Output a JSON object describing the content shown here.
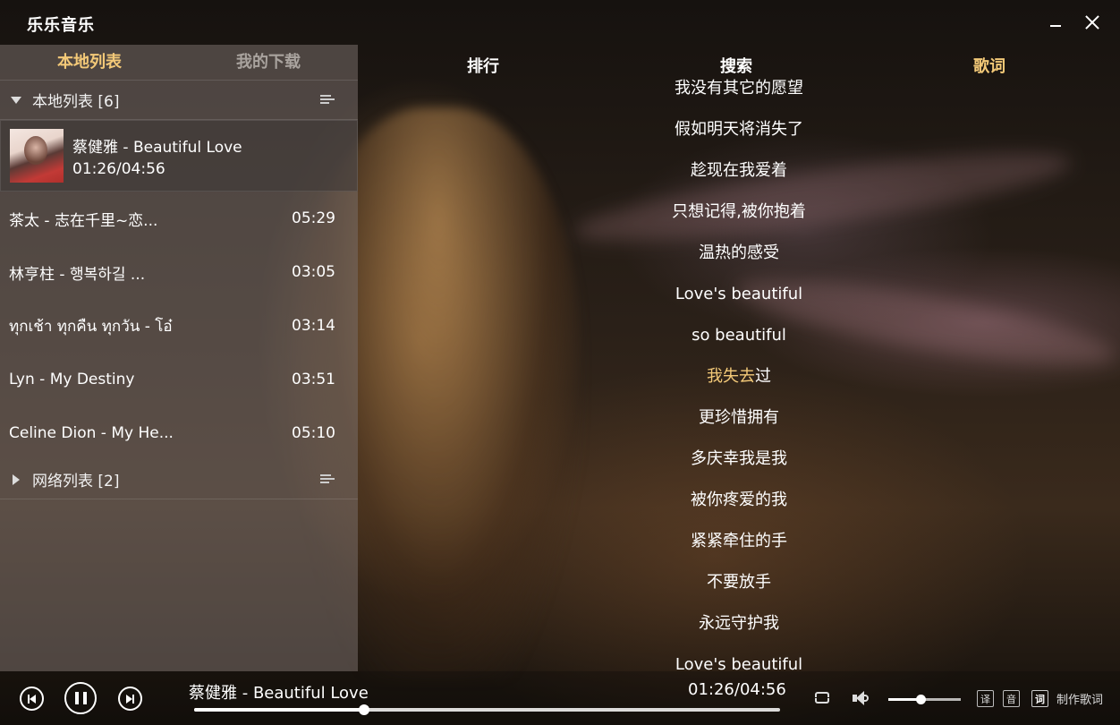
{
  "app": {
    "title": "乐乐音乐"
  },
  "left_tabs": [
    {
      "label": "本地列表",
      "active": true
    },
    {
      "label": "我的下载",
      "active": false
    }
  ],
  "nav_tabs": [
    {
      "label": "排行",
      "active": false
    },
    {
      "label": "搜索",
      "active": false
    },
    {
      "label": "歌词",
      "active": true
    }
  ],
  "local_group": {
    "label": "本地列表 [6]"
  },
  "current_song": {
    "title": "蔡健雅 - Beautiful Love",
    "time": "01:26/04:56"
  },
  "songs": [
    {
      "title": "茶太 - 志在千里~恋...",
      "duration": "05:29"
    },
    {
      "title": "林亨柱 - 행복하길 ...",
      "duration": "03:05"
    },
    {
      "title": "ทุกเช้า ทุกคืน ทุกวัน - โอ๋",
      "duration": "03:14"
    },
    {
      "title": "Lyn - My Destiny",
      "duration": "03:51"
    },
    {
      "title": "Celine Dion - My He...",
      "duration": "05:10"
    }
  ],
  "network_group": {
    "label": "网络列表 [2]"
  },
  "lyrics": [
    "我没有其它的愿望",
    "假如明天将消失了",
    "趁现在我爱着",
    "只想记得,被你抱着",
    "温热的感受",
    "Love's beautiful",
    "so beautiful",
    "我失去过",
    "更珍惜拥有",
    "多庆幸我是我",
    "被你疼爱的我",
    "紧紧牵住的手",
    "不要放手",
    "永远守护我",
    "Love's beautiful"
  ],
  "current_lyric": {
    "index": 7,
    "highlighted": "我失去",
    "rest": "过"
  },
  "player": {
    "title": "蔡健雅 - Beautiful Love",
    "time": "01:26/04:56",
    "progress": 0.29,
    "volume": 0.45,
    "btn_translate": "译",
    "btn_transliterate": "音",
    "btn_lyrics": "词",
    "make_lyrics": "制作歌词"
  },
  "colors": {
    "accent": "#f3c978",
    "text": "#ffffff"
  },
  "icons": [
    "minimize-icon",
    "close-icon",
    "triangle-down-icon",
    "triangle-right-icon",
    "list-menu-icon",
    "prev-icon",
    "pause-icon",
    "next-icon",
    "repeat-icon",
    "volume-icon"
  ]
}
